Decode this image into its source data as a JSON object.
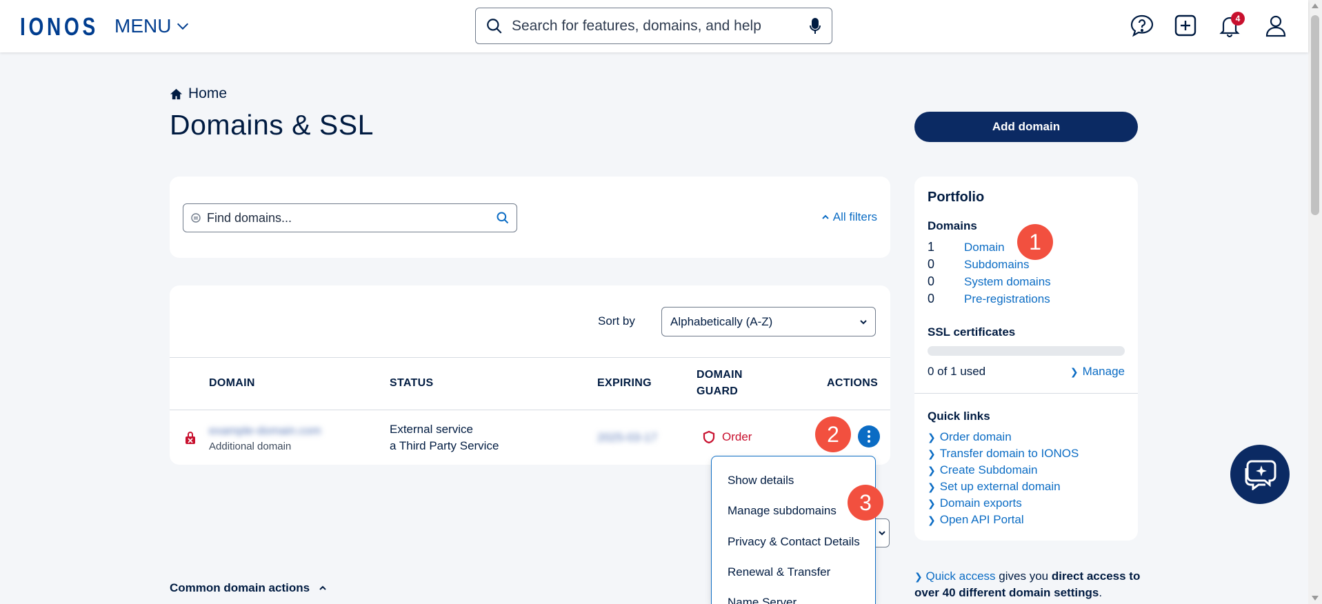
{
  "header": {
    "logo": "IONOS",
    "menu_label": "MENU",
    "search_placeholder": "Search for features, domains, and help",
    "notification_count": "4"
  },
  "breadcrumb": {
    "home": "Home"
  },
  "page": {
    "title": "Domains & SSL",
    "add_domain_label": "Add domain"
  },
  "filters": {
    "find_placeholder": "Find domains...",
    "all_filters_label": "All filters"
  },
  "table": {
    "sort_label": "Sort by",
    "sort_value": "Alphabetically (A-Z)",
    "columns": {
      "domain": "DOMAIN",
      "status": "STATUS",
      "expiring": "EXPIRING",
      "domain_guard_line1": "DOMAIN",
      "domain_guard_line2": "GUARD",
      "actions": "ACTIONS"
    },
    "rows": [
      {
        "domain": "example-domain.com",
        "domain_type": "Additional domain",
        "status_line1": "External service",
        "status_line2": "a Third Party Service",
        "expiring": "2025-03-17",
        "guard": "Order"
      }
    ]
  },
  "actions_menu": {
    "items": [
      "Show details",
      "Manage subdomains",
      "Privacy & Contact Details",
      "Renewal & Transfer",
      "Name Server"
    ]
  },
  "common_actions_label": "Common domain actions",
  "portfolio": {
    "title": "Portfolio",
    "domains_heading": "Domains",
    "domains": [
      {
        "count": "1",
        "label": "Domain"
      },
      {
        "count": "0",
        "label": "Subdomains"
      },
      {
        "count": "0",
        "label": "System domains"
      },
      {
        "count": "0",
        "label": "Pre-registrations"
      }
    ],
    "ssl_heading": "SSL certificates",
    "ssl_used_fraction": 0,
    "ssl_usage_text": "0 of 1 used",
    "manage_label": "Manage",
    "quick_links_heading": "Quick links",
    "quick_links": [
      "Order domain",
      "Transfer domain to IONOS",
      "Create Subdomain",
      "Set up external domain",
      "Domain exports",
      "Open API Portal"
    ]
  },
  "quick_access": {
    "link": "Quick access",
    "text1": " gives you ",
    "bold": "direct access to over 40 different domain settings",
    "text2": "."
  },
  "steps": [
    "1",
    "2",
    "3"
  ],
  "colors": {
    "brand": "#003d8f",
    "primary_button": "#0b2a63",
    "link": "#0b6cc4",
    "alert_red": "#c8102e",
    "step_badge": "#f2503f"
  }
}
